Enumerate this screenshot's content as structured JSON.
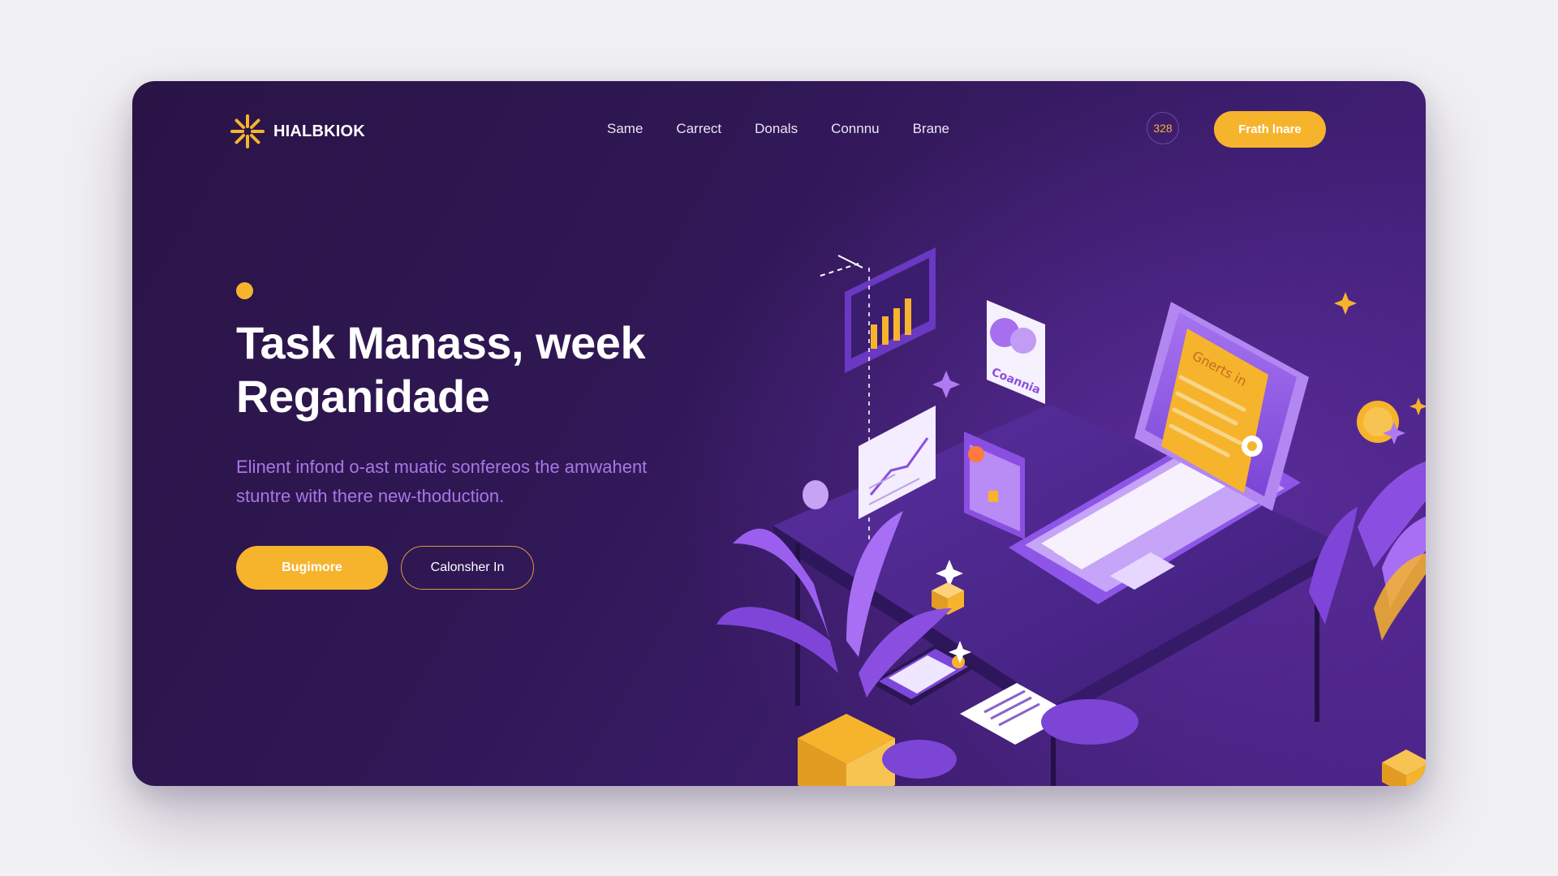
{
  "brand": {
    "name": "HIALBKIOK",
    "logo_icon": "sparkle-logo-icon",
    "accent": "#f6b42d"
  },
  "nav": {
    "items": [
      "Same",
      "Carrect",
      "Donals",
      "Connnu",
      "Brane"
    ]
  },
  "header": {
    "badge": "328",
    "cta_label": "Frath lnare"
  },
  "hero": {
    "title_line1": "Task Manass, week",
    "title_line2": "Reganidade",
    "subtitle_line1": "Elinent infond o-ast muatic sonfereos the amwahent",
    "subtitle_line2": "stuntre with there new-thoduction.",
    "primary_label": "Bugimore",
    "secondary_label": "Calonsher In"
  },
  "illustration": {
    "cloud_card_label": "Coannia",
    "document_heading": "Gnerts in"
  },
  "colors": {
    "background": "#2f1753",
    "accent": "#f6b42d",
    "subtitle": "#a877e6",
    "purple": "#8a4fe0"
  }
}
